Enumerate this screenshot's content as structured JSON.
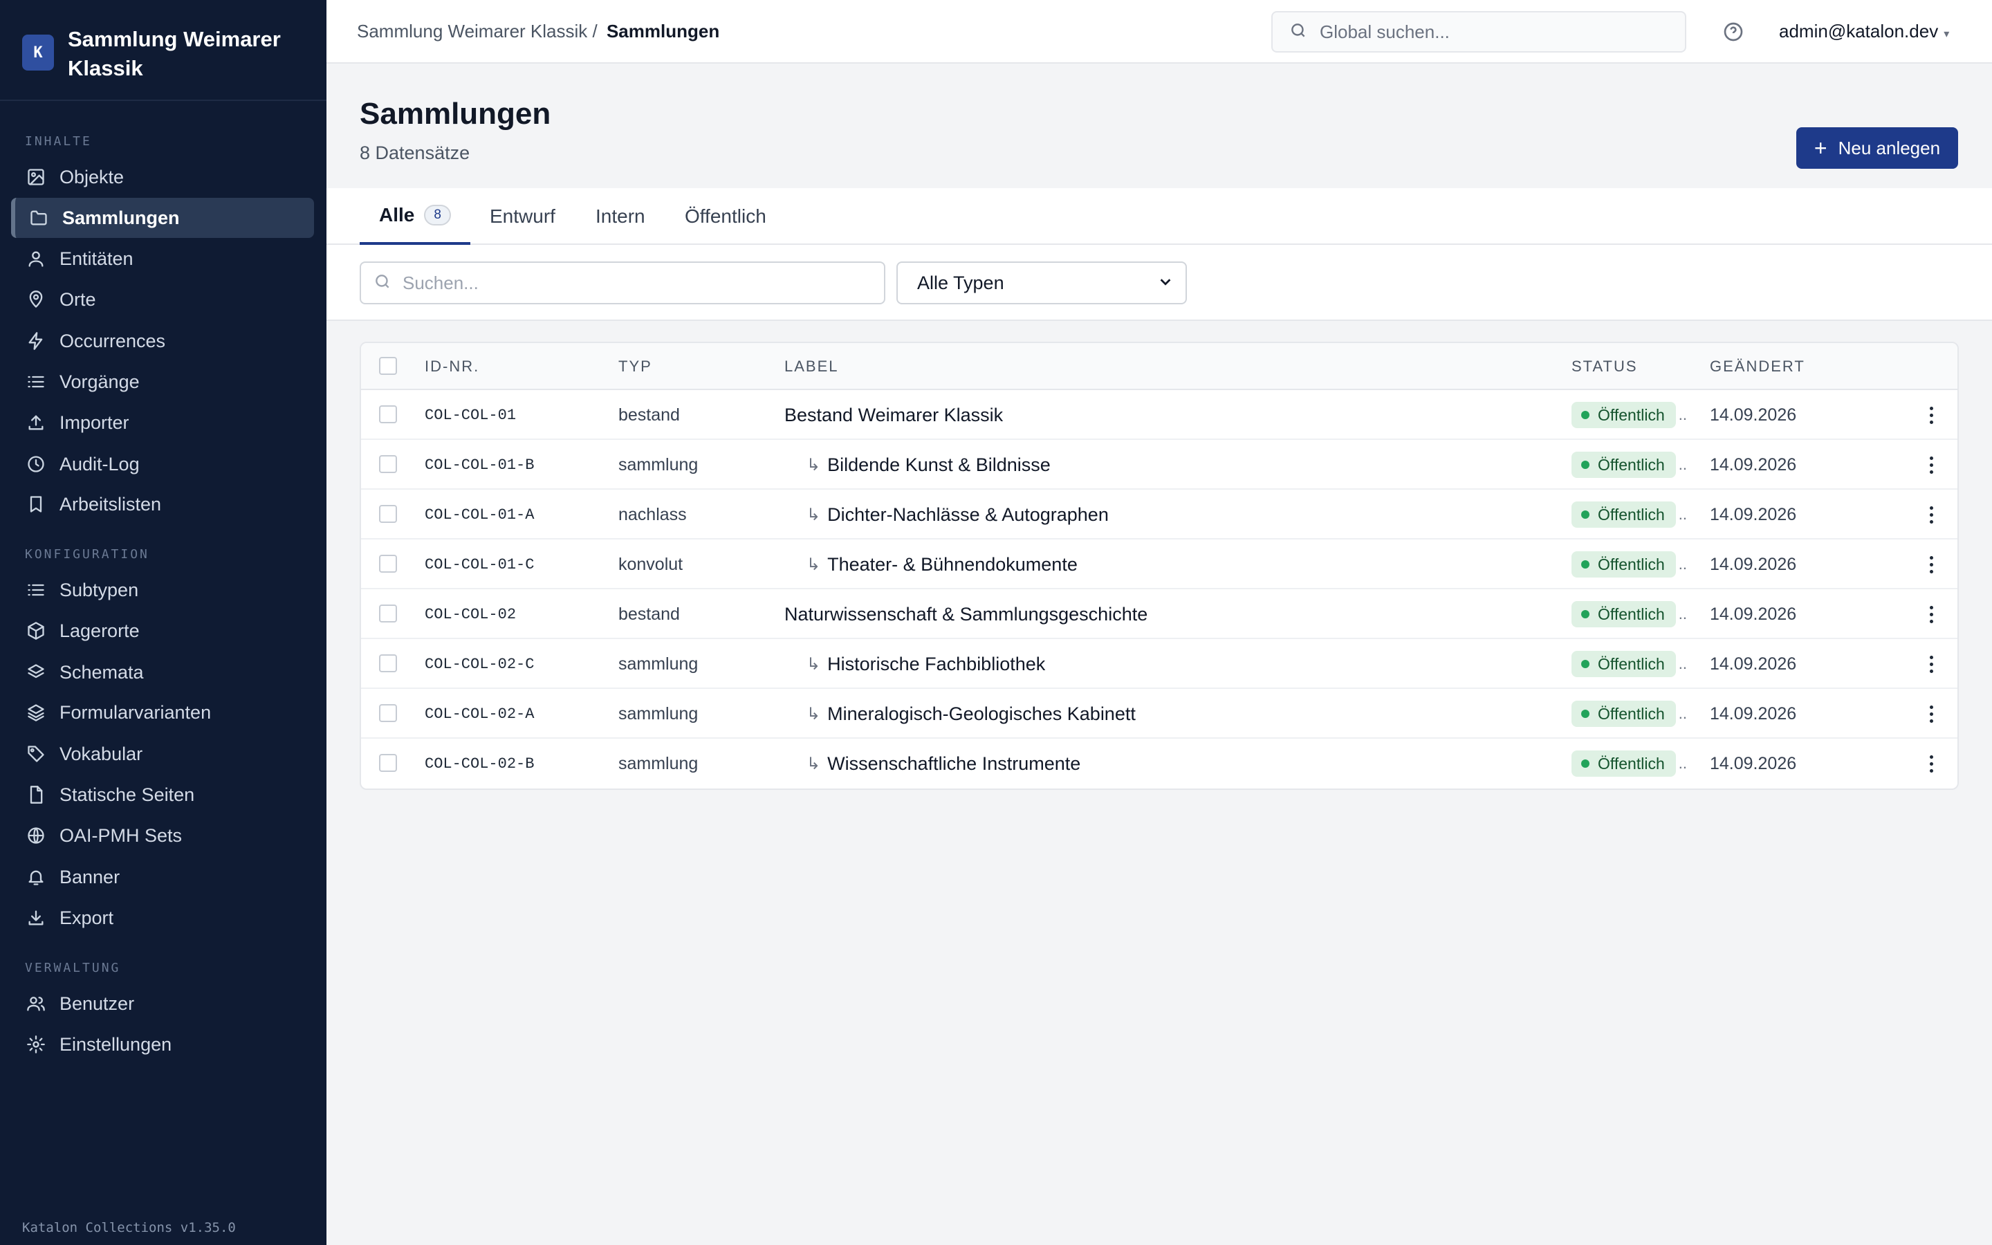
{
  "app": {
    "logo_letter": "K",
    "name": "Sammlung Weimarer Klassik",
    "version": "Katalon Collections v1.35.0"
  },
  "sidebar": {
    "sections": [
      {
        "title": "INHALTE"
      },
      {
        "title": "KONFIGURATION"
      },
      {
        "title": "VERWALTUNG"
      }
    ],
    "items": [
      {
        "label": "Objekte",
        "icon": "image-icon"
      },
      {
        "label": "Sammlungen",
        "icon": "folder-icon",
        "active": true
      },
      {
        "label": "Entitäten",
        "icon": "user-icon"
      },
      {
        "label": "Orte",
        "icon": "map-pin-icon"
      },
      {
        "label": "Occurrences",
        "icon": "zap-icon"
      },
      {
        "label": "Vorgänge",
        "icon": "list-icon"
      },
      {
        "label": "Importer",
        "icon": "upload-icon"
      },
      {
        "label": "Audit-Log",
        "icon": "clock-icon"
      },
      {
        "label": "Arbeitslisten",
        "icon": "bookmark-icon"
      },
      {
        "label": "Subtypen",
        "icon": "list-icon"
      },
      {
        "label": "Lagerorte",
        "icon": "box-icon"
      },
      {
        "label": "Schemata",
        "icon": "layers-icon"
      },
      {
        "label": "Formularvarianten",
        "icon": "layers-icon"
      },
      {
        "label": "Vokabular",
        "icon": "tag-icon"
      },
      {
        "label": "Statische Seiten",
        "icon": "file-icon"
      },
      {
        "label": "OAI-PMH Sets",
        "icon": "globe-icon"
      },
      {
        "label": "Banner",
        "icon": "bell-icon"
      },
      {
        "label": "Export",
        "icon": "download-icon"
      },
      {
        "label": "Benutzer",
        "icon": "users-icon"
      },
      {
        "label": "Einstellungen",
        "icon": "gear-icon"
      }
    ]
  },
  "topbar": {
    "breadcrumb_root": "Sammlung Weimarer Klassik /",
    "breadcrumb_current": "Sammlungen",
    "search_placeholder": "Global suchen...",
    "help_icon": "help-circle-icon",
    "user": "admin@katalon.dev",
    "user_caret": "▾"
  },
  "header": {
    "title": "Sammlungen",
    "subtitle": "8 Datensätze",
    "new_button": "Neu anlegen",
    "new_button_icon": "+"
  },
  "tabs": [
    {
      "label": "Alle",
      "count": "8",
      "active": true
    },
    {
      "label": "Entwurf"
    },
    {
      "label": "Intern"
    },
    {
      "label": "Öffentlich"
    }
  ],
  "filters": {
    "search_placeholder": "Suchen...",
    "type_select": "Alle Typen"
  },
  "table": {
    "columns": [
      "ID-NR.",
      "TYP",
      "LABEL",
      "STATUS",
      "GEÄNDERT"
    ],
    "rows": [
      {
        "id": "COL-COL-01",
        "type": "bestand",
        "label": "Bestand Weimarer Klassik",
        "child": false,
        "status": "Öffentlich",
        "changed": "14.09.2026"
      },
      {
        "id": "COL-COL-01-B",
        "type": "sammlung",
        "label": "Bildende Kunst & Bildnisse",
        "child": true,
        "status": "Öffentlich",
        "changed": "14.09.2026"
      },
      {
        "id": "COL-COL-01-A",
        "type": "nachlass",
        "label": "Dichter-Nachlässe & Autographen",
        "child": true,
        "status": "Öffentlich",
        "changed": "14.09.2026"
      },
      {
        "id": "COL-COL-01-C",
        "type": "konvolut",
        "label": "Theater- & Bühnendokumente",
        "child": true,
        "status": "Öffentlich",
        "changed": "14.09.2026"
      },
      {
        "id": "COL-COL-02",
        "type": "bestand",
        "label": "Naturwissenschaft & Sammlungsgeschichte",
        "child": false,
        "status": "Öffentlich",
        "changed": "14.09.2026"
      },
      {
        "id": "COL-COL-02-C",
        "type": "sammlung",
        "label": "Historische Fachbibliothek",
        "child": true,
        "status": "Öffentlich",
        "changed": "14.09.2026"
      },
      {
        "id": "COL-COL-02-A",
        "type": "sammlung",
        "label": "Mineralogisch-Geologisches Kabinett",
        "child": true,
        "status": "Öffentlich",
        "changed": "14.09.2026"
      },
      {
        "id": "COL-COL-02-B",
        "type": "sammlung",
        "label": "Wissenschaftliche Instrumente",
        "child": true,
        "status": "Öffentlich",
        "changed": "14.09.2026"
      }
    ],
    "child_arrow": "↳",
    "status_overflow": ".."
  },
  "colors": {
    "sidebar_bg": "#0f1b33",
    "accent": "#1e3a8a",
    "status_green": "#22a35a",
    "status_bg": "#dff1e4"
  }
}
